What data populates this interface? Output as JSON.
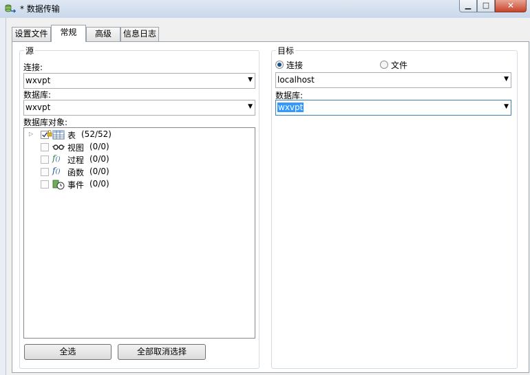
{
  "window": {
    "title": "* 数据传输",
    "icon": "data-transfer-icon",
    "controls": {
      "minimize": "minimize-icon",
      "maximize": "maximize-icon",
      "close": "close-icon"
    }
  },
  "tabs": [
    {
      "label": "设置文件",
      "active": false
    },
    {
      "label": "常规",
      "active": true
    },
    {
      "label": "高级",
      "active": false
    },
    {
      "label": "信息日志",
      "active": false
    }
  ],
  "source": {
    "legend": "源",
    "connection_label": "连接:",
    "connection_value": "wxvpt",
    "database_label": "数据库:",
    "database_value": "wxvpt",
    "objects_label": "数据库对象:",
    "objects": [
      {
        "label": "表",
        "count": "(52/52)",
        "icon": "table-icon",
        "checked": true,
        "expandable": true
      },
      {
        "label": "视图",
        "count": "(0/0)",
        "icon": "glasses-icon",
        "checked": false,
        "expandable": false
      },
      {
        "label": "过程",
        "count": "(0/0)",
        "icon": "procedure-icon",
        "checked": false,
        "expandable": false
      },
      {
        "label": "函数",
        "count": "(0/0)",
        "icon": "function-icon",
        "checked": false,
        "expandable": false
      },
      {
        "label": "事件",
        "count": "(0/0)",
        "icon": "event-clock-icon",
        "checked": false,
        "expandable": false
      }
    ],
    "select_all": "全选",
    "deselect_all": "全部取消选择"
  },
  "target": {
    "legend": "目标",
    "option_connection": "连接",
    "option_file": "文件",
    "selected_option": "连接",
    "connection_value": "localhost",
    "database_label": "数据库:",
    "database_value": "wxvpt"
  }
}
